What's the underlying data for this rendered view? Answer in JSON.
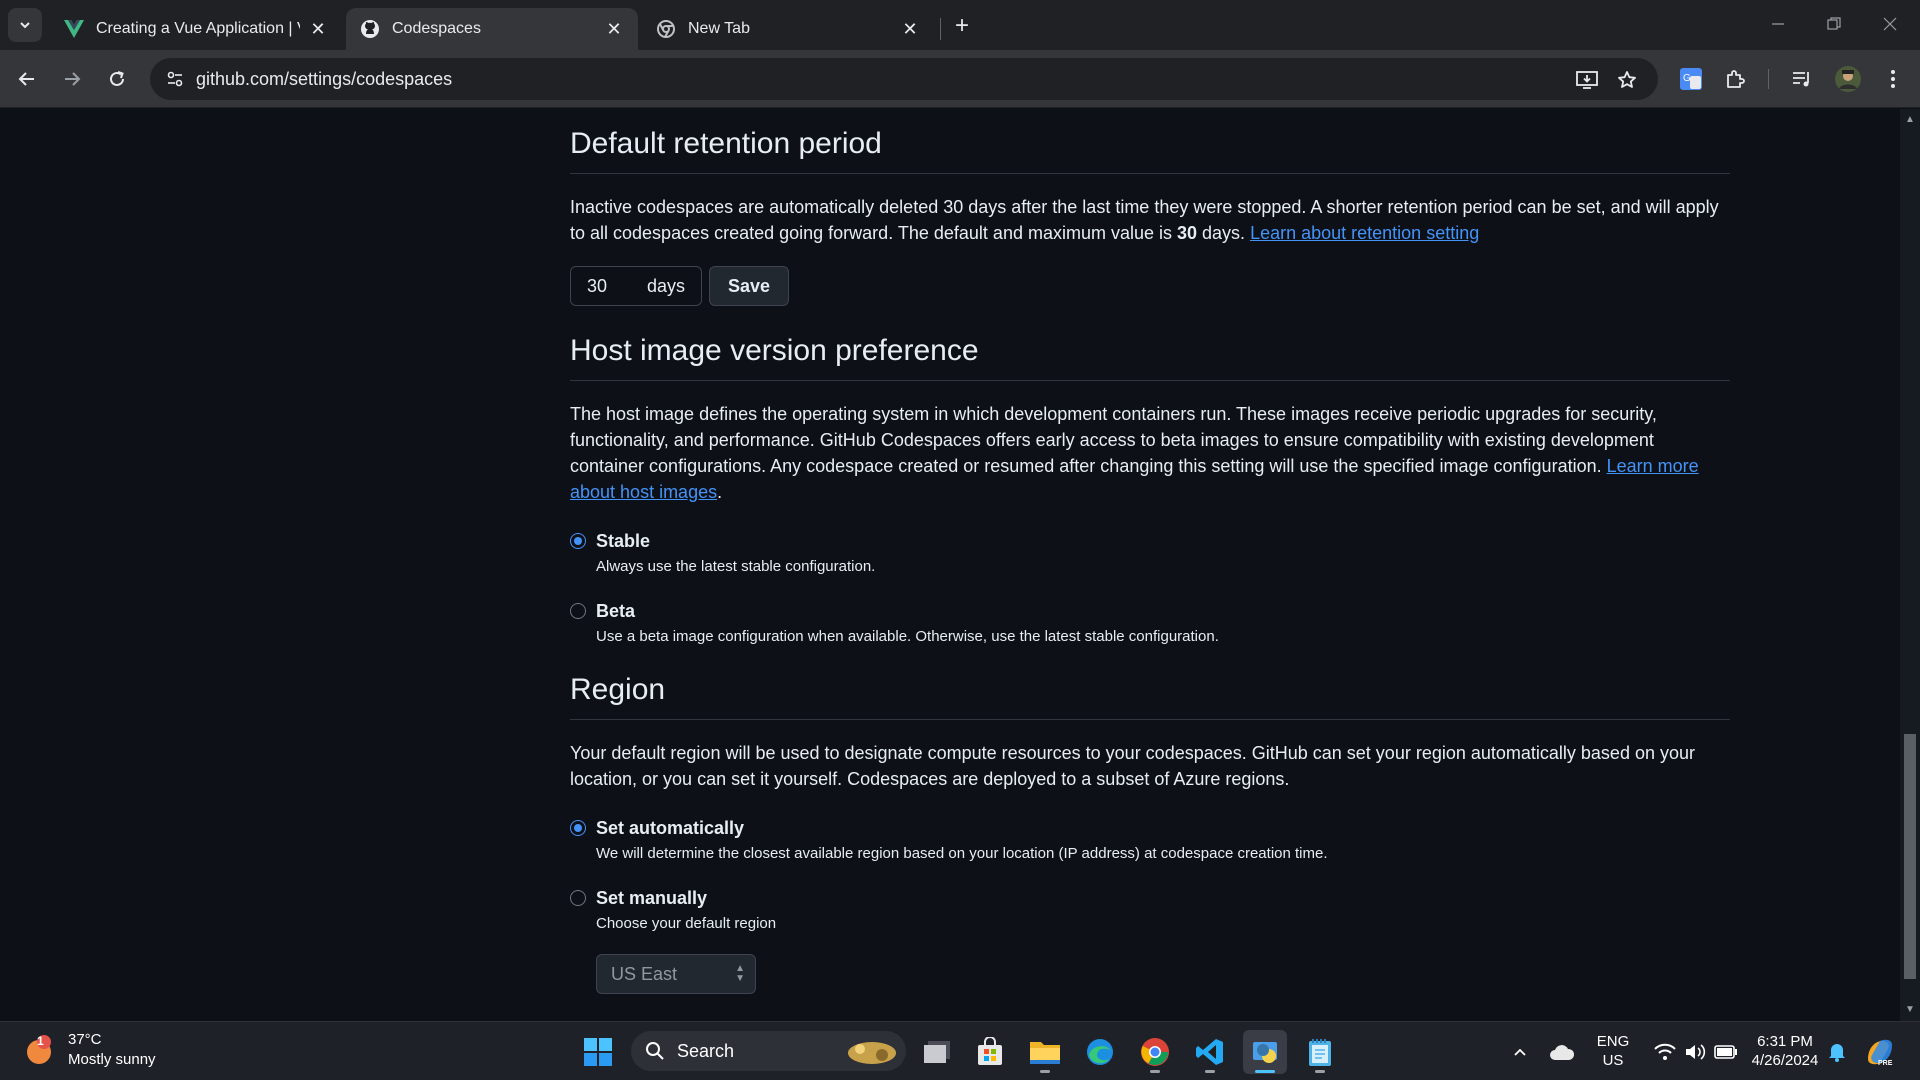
{
  "browser": {
    "tabs": [
      {
        "title": "Creating a Vue Application | Vu",
        "active": false,
        "favicon": "vue-icon"
      },
      {
        "title": "Codespaces",
        "active": true,
        "favicon": "github-icon"
      },
      {
        "title": "New Tab",
        "active": false,
        "favicon": "chrome-icon"
      }
    ],
    "url": "github.com/settings/codespaces"
  },
  "retention": {
    "heading": "Default retention period",
    "text_1": "Inactive codespaces are automatically deleted 30 days after the last time they were stopped. A shorter retention period can be set, and will apply to all codespaces created going forward. The default and maximum value is ",
    "text_bold": "30",
    "text_2": " days. ",
    "link": "Learn about retention setting",
    "days_value": "30",
    "days_unit": "days",
    "save_label": "Save"
  },
  "host_image": {
    "heading": "Host image version preference",
    "text": "The host image defines the operating system in which development containers run. These images receive periodic upgrades for security, functionality, and performance. GitHub Codespaces offers early access to beta images to ensure compatibility with existing development container configurations. Any codespace created or resumed after changing this setting will use the specified image configuration. ",
    "link": "Learn more about host images",
    "link_suffix": ".",
    "options": [
      {
        "label": "Stable",
        "description": "Always use the latest stable configuration.",
        "checked": true
      },
      {
        "label": "Beta",
        "description": "Use a beta image configuration when available. Otherwise, use the latest stable configuration.",
        "checked": false
      }
    ]
  },
  "region": {
    "heading": "Region",
    "text": "Your default region will be used to designate compute resources to your codespaces. GitHub can set your region automatically based on your location, or you can set it yourself. Codespaces are deployed to a subset of Azure regions.",
    "options": [
      {
        "label": "Set automatically",
        "description": "We will determine the closest available region based on your location (IP address) at codespace creation time.",
        "checked": true
      },
      {
        "label": "Set manually",
        "description": "Choose your default region",
        "checked": false
      }
    ],
    "select_value": "US East"
  },
  "taskbar": {
    "weather_temp": "37°C",
    "weather_desc": "Mostly sunny",
    "weather_badge": "1",
    "search_label": "Search",
    "lang_1": "ENG",
    "lang_2": "US",
    "time": "6:31 PM",
    "date": "4/26/2024"
  },
  "colors": {
    "page_bg": "#0d1117",
    "link": "#4493f8",
    "chrome_tabbar": "#202124",
    "chrome_toolbar": "#35363a"
  }
}
